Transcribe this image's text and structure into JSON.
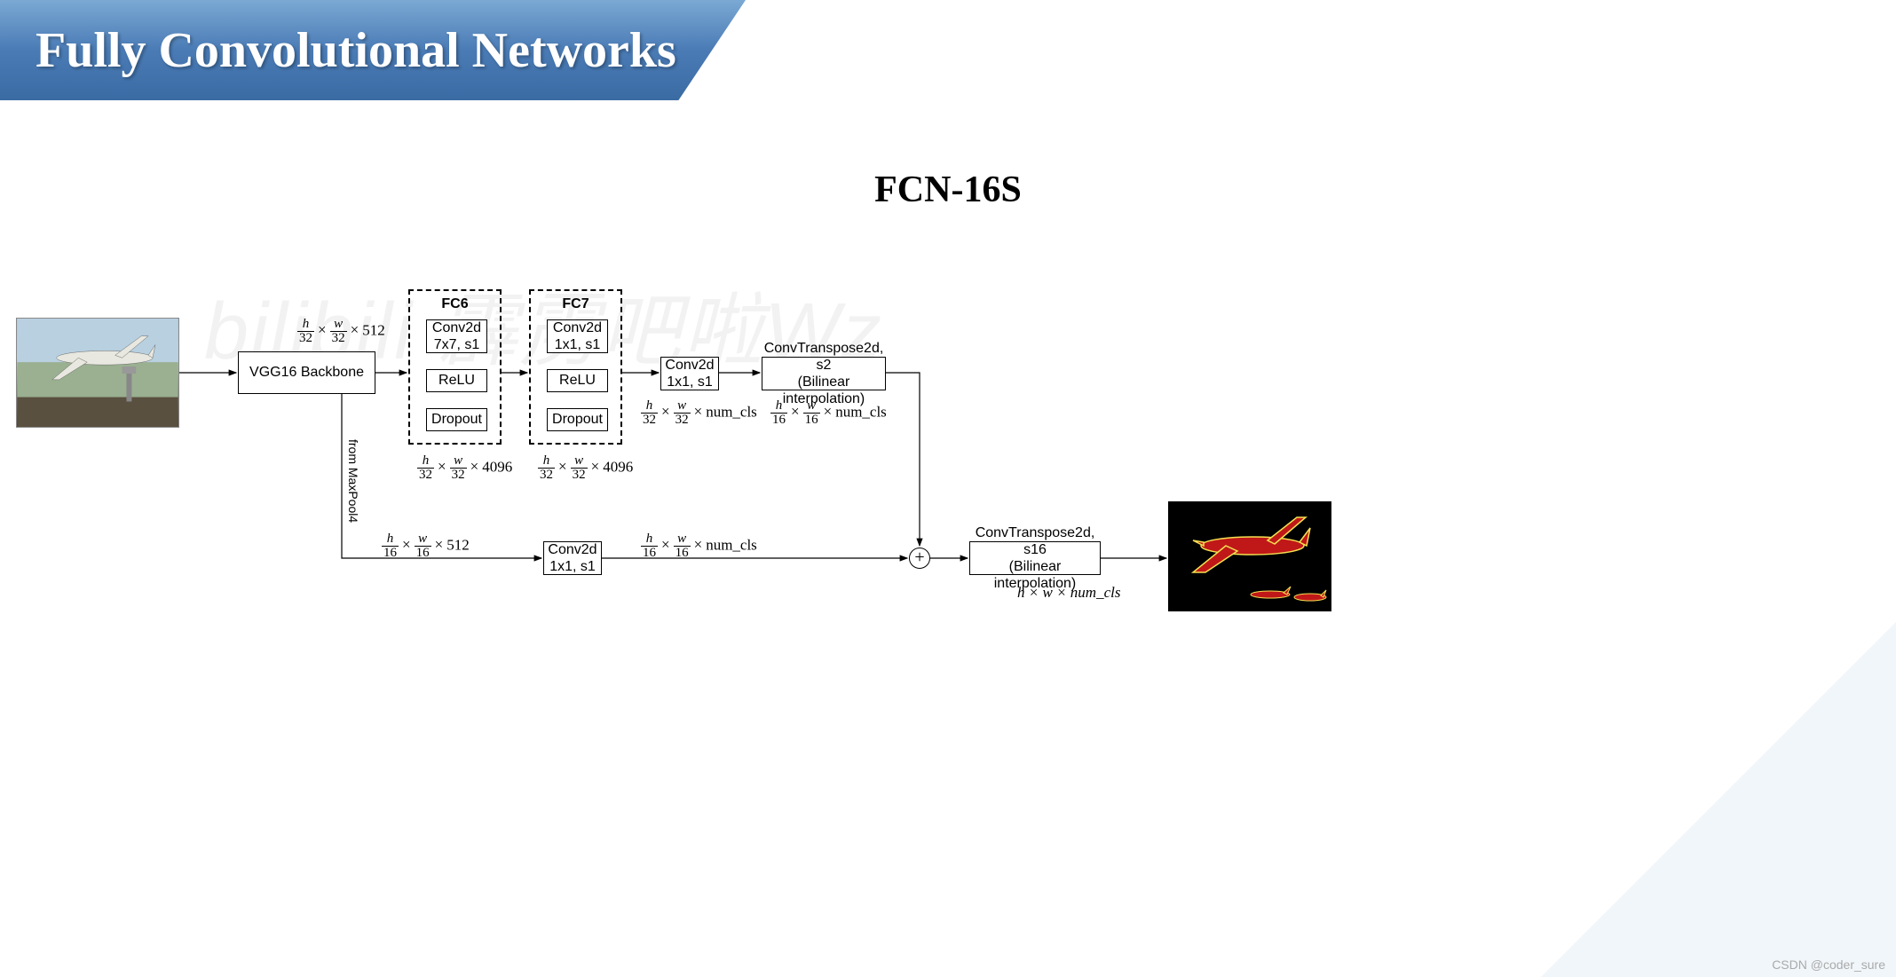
{
  "header": {
    "title": "Fully Convolutional Networks"
  },
  "subtitle": "FCN-16S",
  "watermark": "bilibili 霹雳吧啦Wz",
  "nodes": {
    "vgg": "VGG16 Backbone",
    "fc6_title": "FC6",
    "fc6_conv": "Conv2d\n7x7, s1",
    "fc6_relu": "ReLU",
    "fc6_drop": "Dropout",
    "fc7_title": "FC7",
    "fc7_conv": "Conv2d\n1x1, s1",
    "fc7_relu": "ReLU",
    "fc7_drop": "Dropout",
    "conv_after_fc7": "Conv2d\n1x1, s1",
    "convtrans_s2": "ConvTranspose2d, s2\n(Bilinear interpolation)",
    "skip_conv": "Conv2d\n1x1, s1",
    "convtrans_s16": "ConvTranspose2d, s16\n(Bilinear interpolation)",
    "frommaxpool": "from MaxPool4"
  },
  "dims": {
    "d_32_512": {
      "h": "h",
      "hd": "32",
      "w": "w",
      "wd": "32",
      "ch": "512"
    },
    "d_32_4096_a": {
      "h": "h",
      "hd": "32",
      "w": "w",
      "wd": "32",
      "ch": "4096"
    },
    "d_32_4096_b": {
      "h": "h",
      "hd": "32",
      "w": "w",
      "wd": "32",
      "ch": "4096"
    },
    "d_32_numcls": {
      "h": "h",
      "hd": "32",
      "w": "w",
      "wd": "32",
      "ch": "num_cls"
    },
    "d_16_numcls_a": {
      "h": "h",
      "hd": "16",
      "w": "w",
      "wd": "16",
      "ch": "num_cls"
    },
    "d_16_512": {
      "h": "h",
      "hd": "16",
      "w": "w",
      "wd": "16",
      "ch": "512"
    },
    "d_16_numcls_b": {
      "h": "h",
      "hd": "16",
      "w": "w",
      "wd": "16",
      "ch": "num_cls"
    },
    "final": "h × w × num_cls"
  },
  "footer": "CSDN @coder_sure"
}
